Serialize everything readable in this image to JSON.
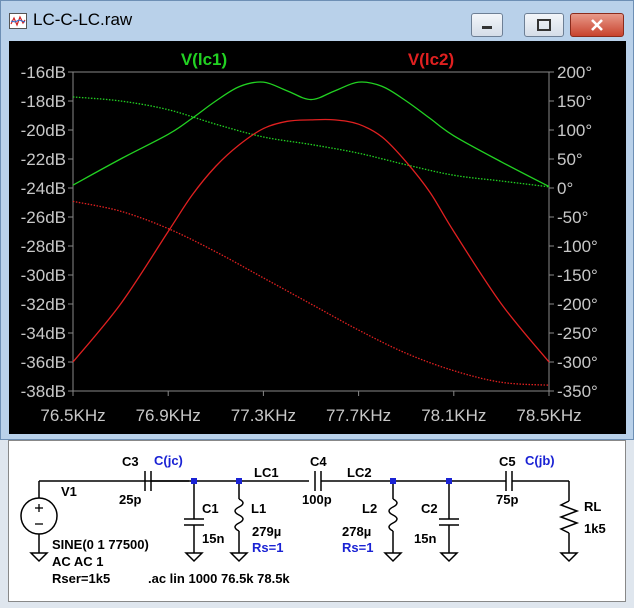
{
  "window": {
    "title": "LC-C-LC.raw",
    "minimize_icon": "minimize-icon",
    "maximize_icon": "maximize-icon",
    "close_icon": "close-icon"
  },
  "plot": {
    "trace1_label": "V(lc1)",
    "trace2_label": "V(lc2)",
    "colors": {
      "trace1": "#22d122",
      "trace2": "#e02020",
      "axis": "#888888",
      "background": "#000000"
    },
    "y_left_ticks": [
      "-16dB",
      "-18dB",
      "-20dB",
      "-22dB",
      "-24dB",
      "-26dB",
      "-28dB",
      "-30dB",
      "-32dB",
      "-34dB",
      "-36dB",
      "-38dB"
    ],
    "y_right_ticks": [
      "200°",
      "150°",
      "100°",
      "50°",
      "0°",
      "-50°",
      "-100°",
      "-150°",
      "-200°",
      "-250°",
      "-300°",
      "-350°"
    ],
    "x_ticks": [
      "76.5KHz",
      "76.9KHz",
      "77.3KHz",
      "77.7KHz",
      "78.1KHz",
      "78.5KHz"
    ]
  },
  "chart_data": {
    "type": "line",
    "title": "",
    "xlabel": "",
    "ylabel": "",
    "x_range": [
      76.5,
      78.5
    ],
    "x_unit": "KHz",
    "y_left_range": [
      -38,
      -16
    ],
    "y_right_range": [
      -350,
      200
    ],
    "series": [
      {
        "name": "V(lc1)",
        "kind": "magnitude_dB",
        "x": [
          76.5,
          76.7,
          76.9,
          77.0,
          77.1,
          77.2,
          77.3,
          77.4,
          77.5,
          77.6,
          77.7,
          77.8,
          77.9,
          78.0,
          78.1,
          78.3,
          78.5
        ],
        "y": [
          -23.8,
          -22.0,
          -20.3,
          -19.2,
          -18.0,
          -17.0,
          -16.7,
          -17.3,
          -17.9,
          -17.3,
          -16.7,
          -17.0,
          -18.0,
          -19.2,
          -20.4,
          -22.2,
          -23.9
        ]
      },
      {
        "name": "V(lc1)",
        "kind": "phase_deg",
        "x": [
          76.5,
          76.7,
          76.9,
          77.1,
          77.3,
          77.5,
          77.7,
          77.9,
          78.1,
          78.3,
          78.5
        ],
        "y": [
          157,
          150,
          135,
          110,
          88,
          75,
          60,
          40,
          22,
          12,
          2
        ]
      },
      {
        "name": "V(lc2)",
        "kind": "magnitude_dB",
        "x": [
          76.5,
          76.7,
          76.9,
          77.0,
          77.1,
          77.2,
          77.3,
          77.4,
          77.5,
          77.6,
          77.7,
          77.8,
          77.9,
          78.0,
          78.1,
          78.3,
          78.5
        ],
        "y": [
          -36.0,
          -32.0,
          -27.0,
          -24.5,
          -22.5,
          -21.0,
          -19.9,
          -19.4,
          -19.3,
          -19.3,
          -19.6,
          -20.5,
          -22.2,
          -24.3,
          -27.0,
          -32.0,
          -36.0
        ]
      },
      {
        "name": "V(lc2)",
        "kind": "phase_deg",
        "x": [
          76.5,
          76.7,
          76.9,
          77.1,
          77.3,
          77.5,
          77.7,
          77.9,
          78.1,
          78.3,
          78.5
        ],
        "y": [
          -23,
          -40,
          -70,
          -110,
          -155,
          -200,
          -245,
          -285,
          -315,
          -335,
          -340
        ]
      }
    ],
    "grid": false,
    "legend": "top"
  },
  "schematic": {
    "labels": {
      "c3": "C3",
      "c3_val": "25p",
      "net_jc": "C(jc)",
      "c1": "C1",
      "c1_val": "15n",
      "lc1": "LC1",
      "l1": "L1",
      "l1_val": "279µ",
      "l1_rs": "Rs=1",
      "c4": "C4",
      "c4_val": "100p",
      "lc2": "LC2",
      "l2": "L2",
      "l2_val": "278µ",
      "l2_rs": "Rs=1",
      "c2": "C2",
      "c2_val": "15n",
      "c5": "C5",
      "c5_val": "75p",
      "net_jb": "C(jb)",
      "rl": "RL",
      "rl_val": "1k5",
      "v1": "V1",
      "v1_val": "SINE(0 1 77500)",
      "v1_ac": "AC AC 1",
      "v1_rser": "Rser=1k5",
      "directive": ".ac lin 1000 76.5k 78.5k"
    }
  }
}
